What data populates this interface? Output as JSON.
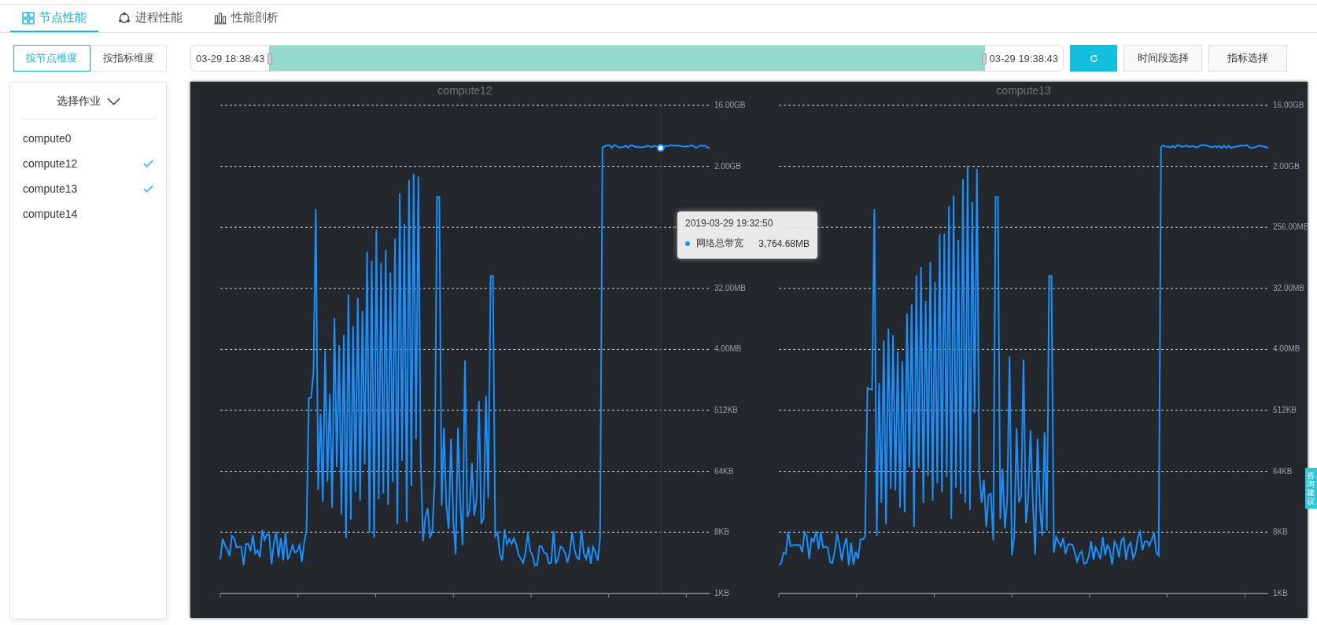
{
  "tabs": [
    {
      "label": "节点性能",
      "selected": true
    },
    {
      "label": "进程性能",
      "selected": false
    },
    {
      "label": "性能剖析",
      "selected": false
    }
  ],
  "view_toggle": [
    {
      "label": "按节点维度",
      "selected": true
    },
    {
      "label": "按指标维度",
      "selected": false
    }
  ],
  "job_select": {
    "label": "选择作业"
  },
  "nodes": [
    {
      "label": "compute0",
      "checked": false
    },
    {
      "label": "compute12",
      "checked": true
    },
    {
      "label": "compute13",
      "checked": true
    },
    {
      "label": "compute14",
      "checked": false
    }
  ],
  "time_range": {
    "start": "03-29 18:38:43",
    "end": "03-29 19:38:43",
    "level": 1
  },
  "buttons": [
    "时间段选择",
    "指标选择"
  ],
  "charts": [
    {
      "title": "compute12",
      "y_ticks": [
        {
          "label": "16.00GB"
        },
        {
          "label": "2.00GB"
        },
        {
          "covered": true
        },
        {
          "label": "32.00MB"
        },
        {
          "label": "4.00MB"
        },
        {
          "label": "512KB"
        },
        {
          "label": "64KB"
        },
        {
          "label": "8KB"
        },
        {
          "label": "1KB"
        }
      ],
      "tooltip": {
        "time": "2019-03-29 19:32:50",
        "series": "网络总带宽",
        "value": "3,764.68MB",
        "color": "#1890ff"
      }
    },
    {
      "title": "compute13",
      "y_ticks": [
        {
          "label": "16.00GB"
        },
        {
          "label": "2.00GB"
        },
        {
          "label": "256.00MB"
        },
        {
          "label": "32.00MB"
        },
        {
          "label": "4.00MB"
        },
        {
          "label": "512KB"
        },
        {
          "label": "64KB"
        },
        {
          "label": "8KB"
        },
        {
          "label": "1KB"
        }
      ]
    }
  ],
  "feedback_tab": {
    "label": "咨询建议"
  }
}
